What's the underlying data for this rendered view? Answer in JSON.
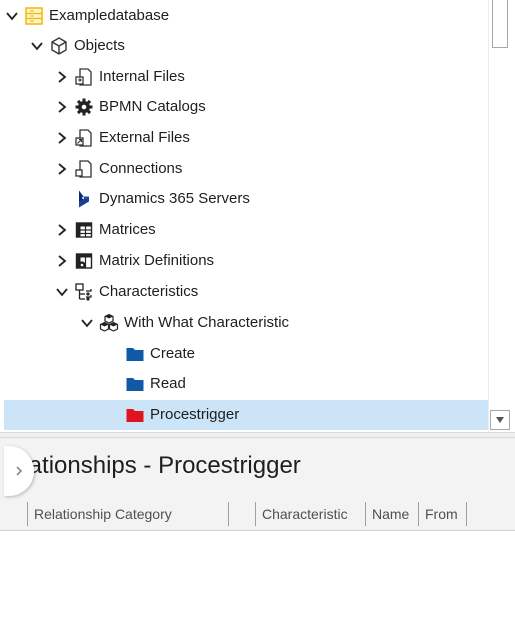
{
  "tree": {
    "items": [
      {
        "label": "Exampledatabase",
        "icon": "database-icon",
        "expanded": true
      },
      {
        "label": "Objects",
        "icon": "cube-icon",
        "expanded": true
      },
      {
        "label": "Internal Files",
        "icon": "internal-file-icon",
        "expanded": false
      },
      {
        "label": "BPMN Catalogs",
        "icon": "gear-icon",
        "expanded": false
      },
      {
        "label": "External Files",
        "icon": "external-file-icon",
        "expanded": false
      },
      {
        "label": "Connections",
        "icon": "connection-icon",
        "expanded": false
      },
      {
        "label": "Dynamics 365 Servers",
        "icon": "dynamics-365-icon"
      },
      {
        "label": "Matrices",
        "icon": "matrix-icon",
        "expanded": false
      },
      {
        "label": "Matrix Definitions",
        "icon": "matrix-definition-icon",
        "expanded": false
      },
      {
        "label": "Characteristics",
        "icon": "characteristics-icon",
        "expanded": true
      },
      {
        "label": "With What Characteristic",
        "icon": "characteristic-group-icon",
        "expanded": true
      },
      {
        "label": "Create",
        "icon": "blue-folder-icon"
      },
      {
        "label": "Read",
        "icon": "blue-folder-icon"
      },
      {
        "label": "Procestrigger",
        "icon": "red-folder-icon",
        "selected": true
      }
    ]
  },
  "relationships": {
    "title": "elationships - Procestrigger",
    "columns": [
      "Relationship Category",
      "",
      "Characteristic",
      "Name",
      "From"
    ]
  },
  "colors": {
    "selection": "#cce4f7",
    "folder_blue": "#0e5aa7",
    "folder_red": "#e0141e",
    "db_yellow": "#f2b705"
  }
}
